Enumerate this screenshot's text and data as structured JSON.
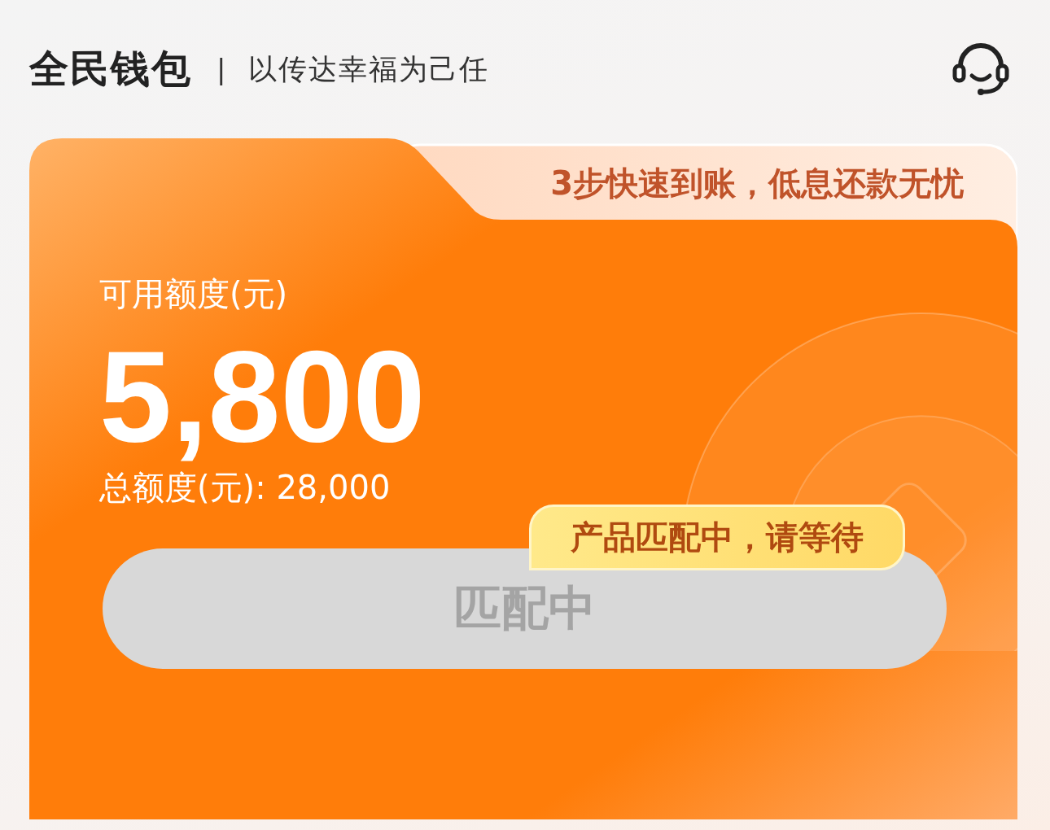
{
  "header": {
    "logo": "全民钱包",
    "divider": "|",
    "slogan": "以传达幸福为己任"
  },
  "card": {
    "banner": "3步快速到账，低息还款无忧",
    "available_label": "可用额度(元)",
    "available_amount": "5,800",
    "total_label": "总额度(元): 28,000",
    "button": {
      "label": "匹配中",
      "disabled": true
    },
    "badge": "产品匹配中，请等待"
  }
}
